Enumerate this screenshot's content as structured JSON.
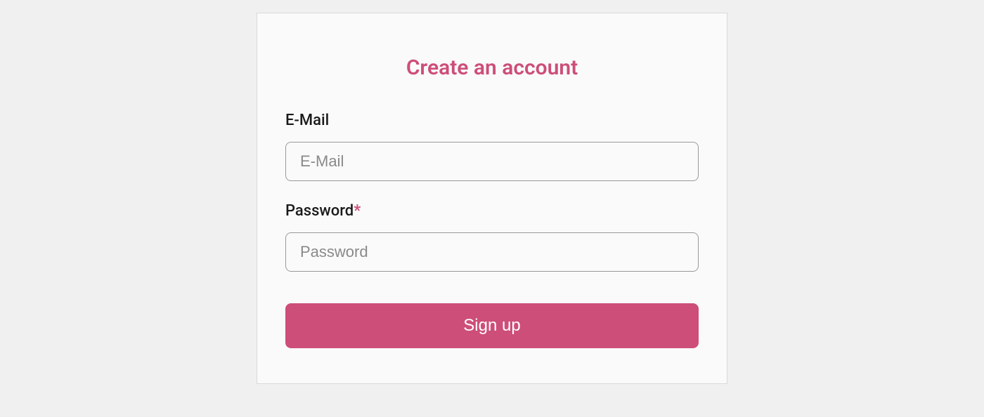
{
  "form": {
    "title": "Create an account",
    "email": {
      "label": "E-Mail",
      "placeholder": "E-Mail",
      "value": ""
    },
    "password": {
      "label": "Password",
      "required_marker": "*",
      "placeholder": "Password",
      "value": ""
    },
    "submit_label": "Sign up"
  }
}
